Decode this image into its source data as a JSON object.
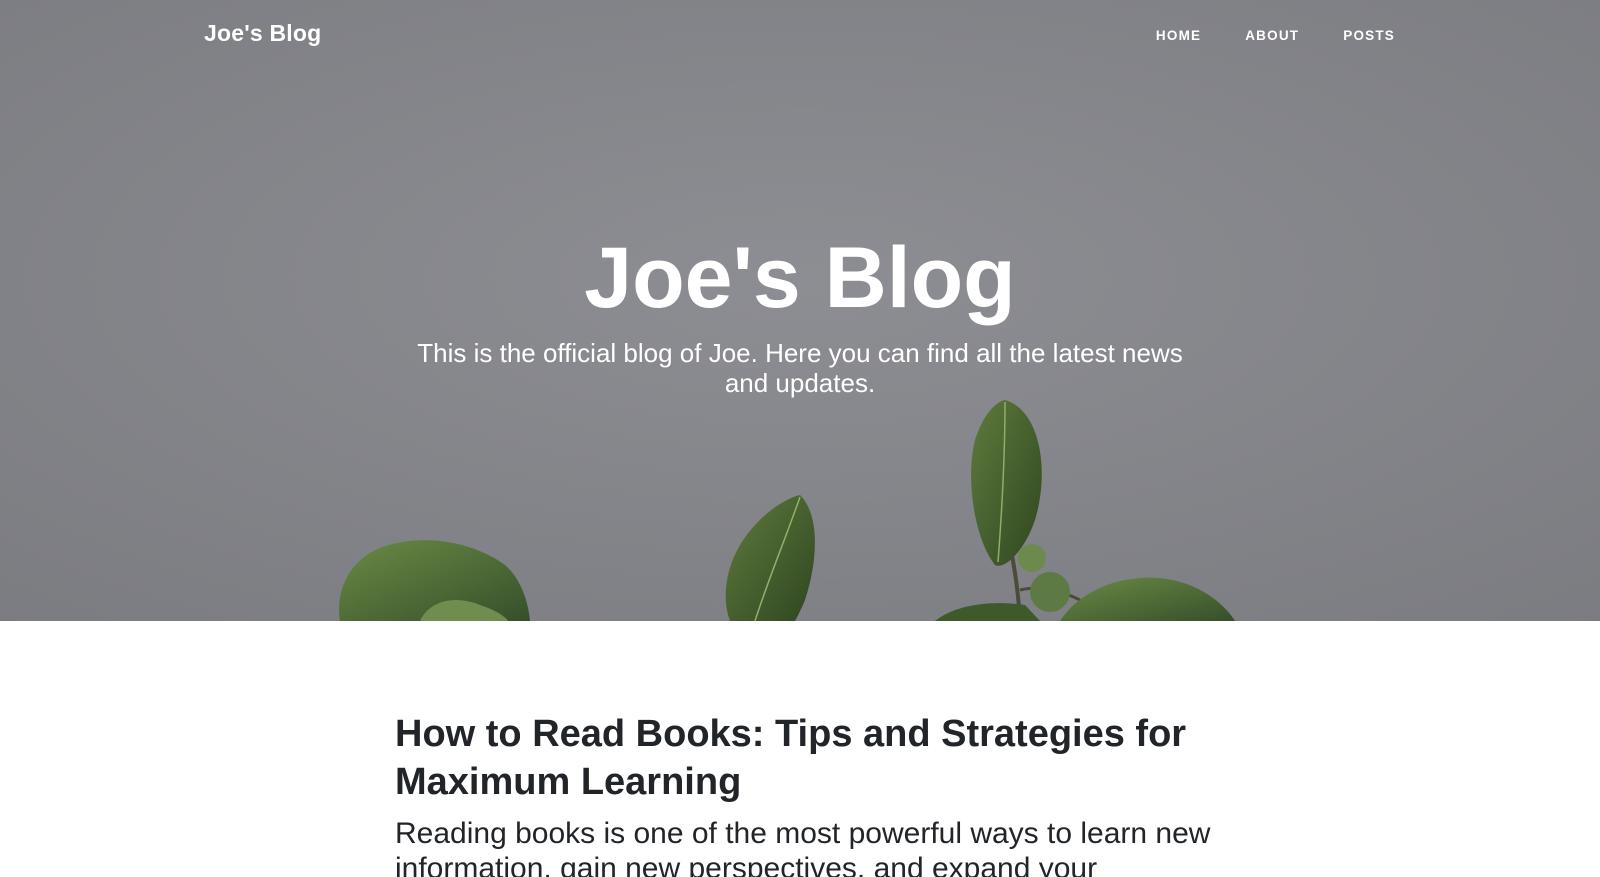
{
  "navbar": {
    "brand": "Joe's Blog",
    "links": [
      {
        "label": "HOME"
      },
      {
        "label": "ABOUT"
      },
      {
        "label": "POSTS"
      }
    ]
  },
  "hero": {
    "heading": "Joe's Blog",
    "subheading": "This is the official blog of Joe. Here you can find all the latest news and updates.",
    "background_color": "#85868b",
    "image": "plant-leaves-image"
  },
  "post": {
    "title": "How to Read Books: Tips and Strategies for Maximum Learning",
    "excerpt": "Reading books is one of the most powerful ways to learn new information, gain new perspectives, and expand your"
  },
  "colors": {
    "text_dark": "#212529",
    "hero_text": "#ffffff",
    "leaf": "#3f5a2a"
  }
}
